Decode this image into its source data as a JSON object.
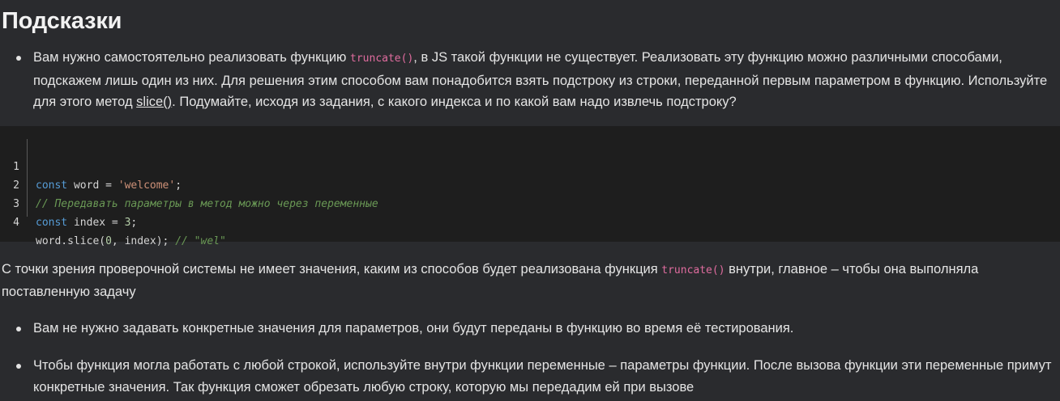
{
  "heading": "Подсказки",
  "hint1": {
    "text_before": "Вам нужно самостоятельно реализовать функцию ",
    "code": "truncate()",
    "text_middle": ", в JS такой функции не существует. Реализовать эту функцию можно различными способами, подскажем лишь один из них. Для решения этим способом вам понадобится взять подстроку из строки, переданной первым параметром в функцию. Используйте для этого метод ",
    "link": "slice()",
    "text_after": ". Подумайте, исходя из задания, с какого индекса и по какой вам надо извлечь подстроку?"
  },
  "code_block": {
    "line_numbers": [
      "1",
      "2",
      "3",
      "4"
    ],
    "line1": {
      "kw": "const",
      "rest": " word = ",
      "str": "'welcome'",
      "end": ";"
    },
    "line2": {
      "comment": "// Передавать параметры в метод можно через переменные"
    },
    "line3": {
      "kw": "const",
      "rest": " index = ",
      "num": "3",
      "end": ";"
    },
    "line4": {
      "a": "word.slice(",
      "num": "0",
      "b": ", index); ",
      "comment": "// \"wel\""
    }
  },
  "paragraph": {
    "text_before": "С точки зрения проверочной системы не имеет значения, каким из способов будет реализована функция ",
    "code": "truncate()",
    "text_after": " внутри, главное – чтобы она выполняла поставленную задачу"
  },
  "hint2": {
    "text": "Вам не нужно задавать конкретные значения для параметров, они будут переданы в функцию во время её тестирования."
  },
  "hint3": {
    "text": "Чтобы функция могла работать с любой строкой, используйте внутри функции переменные – параметры функции. После вызова функции эти переменные примут конкретные значения. Так функция сможет обрезать любую строку, которую мы передадим ей при вызове"
  }
}
